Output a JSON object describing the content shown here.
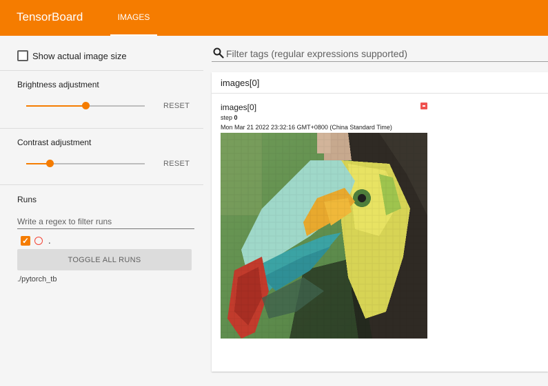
{
  "header": {
    "brand": "TensorBoard",
    "tab_label": "IMAGES",
    "color": "#f57c00"
  },
  "sidebar": {
    "show_actual_size_label": "Show actual image size",
    "show_actual_size_checked": false,
    "brightness": {
      "label": "Brightness adjustment",
      "reset": "RESET",
      "value": 0.5
    },
    "contrast": {
      "label": "Contrast adjustment",
      "reset": "RESET",
      "value": 0.2
    },
    "runs": {
      "heading": "Runs",
      "filter_placeholder": "Write a regex to filter runs",
      "items": [
        {
          "name": ".",
          "checked": true,
          "color": "#f44336"
        }
      ],
      "toggle_label": "TOGGLE ALL RUNS",
      "dir": "./pytorch_tb"
    }
  },
  "main": {
    "filter_placeholder": "Filter tags (regular expressions supported)",
    "panel_title": "images[0]",
    "card": {
      "title": "images[0]",
      "step_label": "step",
      "step_value": "0",
      "timestamp": "Mon Mar 21 2022 23:32:16 GMT+0800 (China Standard Time)"
    }
  }
}
